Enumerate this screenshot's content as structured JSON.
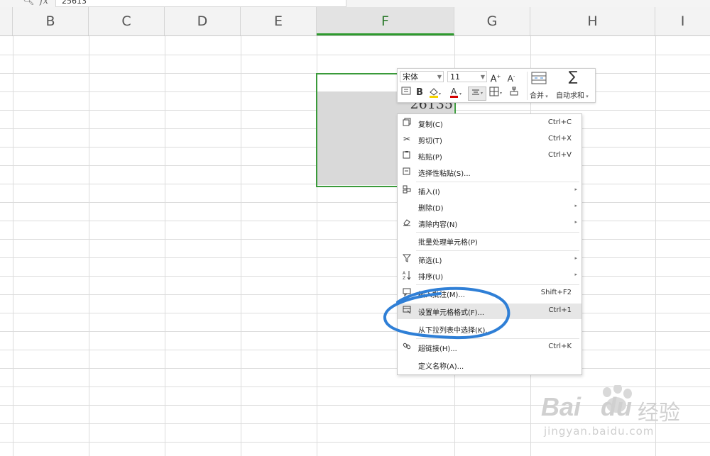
{
  "formula_bar": {
    "fx": "fx",
    "value": "25613"
  },
  "columns": [
    {
      "letter": "B"
    },
    {
      "letter": "C"
    },
    {
      "letter": "D"
    },
    {
      "letter": "E"
    },
    {
      "letter": "F",
      "selected": true
    },
    {
      "letter": "G"
    },
    {
      "letter": "H"
    },
    {
      "letter": "I"
    }
  ],
  "cell": {
    "value": "26135"
  },
  "mini_toolbar": {
    "font": "宋体",
    "size": "11",
    "merge": "合并",
    "autosum": "自动求和",
    "bold": "B"
  },
  "context_menu": {
    "items": [
      {
        "label": "复制(C)",
        "shortcut": "Ctrl+C",
        "icon": "copy-icon"
      },
      {
        "label": "剪切(T)",
        "shortcut": "Ctrl+X",
        "icon": "scissors-icon"
      },
      {
        "label": "粘贴(P)",
        "shortcut": "Ctrl+V",
        "icon": "paste-icon"
      },
      {
        "label": "选择性粘贴(S)...",
        "shortcut": "",
        "icon": "paste-special-icon"
      },
      {
        "label": "插入(I)",
        "shortcut": "",
        "icon": "insert-icon",
        "submenu": true
      },
      {
        "label": "删除(D)",
        "shortcut": "",
        "icon": "",
        "submenu": true
      },
      {
        "label": "清除内容(N)",
        "shortcut": "",
        "icon": "eraser-icon",
        "submenu": true
      },
      {
        "label": "批量处理单元格(P)",
        "shortcut": "",
        "icon": ""
      },
      {
        "label": "筛选(L)",
        "shortcut": "",
        "icon": "filter-icon",
        "submenu": true
      },
      {
        "label": "排序(U)",
        "shortcut": "",
        "icon": "sort-icon",
        "submenu": true
      },
      {
        "label": "插入批注(M)...",
        "shortcut": "Shift+F2",
        "icon": "comment-icon"
      },
      {
        "label": "设置单元格格式(F)...",
        "shortcut": "Ctrl+1",
        "icon": "format-cells-icon",
        "highlight": true
      },
      {
        "label": "从下拉列表中选择(K)...",
        "shortcut": "",
        "icon": ""
      },
      {
        "label": "超链接(H)...",
        "shortcut": "Ctrl+K",
        "icon": "link-icon"
      },
      {
        "label": "定义名称(A)...",
        "shortcut": "",
        "icon": ""
      }
    ]
  },
  "watermark": {
    "brand_left": "Bai",
    "brand_right": "du",
    "jingyan": "经验",
    "url": "jingyan.baidu.com"
  },
  "colors": {
    "selection_green": "#3a9a3a",
    "annotation_blue": "#2f7fd6",
    "menu_highlight": "#e6e6e6"
  }
}
